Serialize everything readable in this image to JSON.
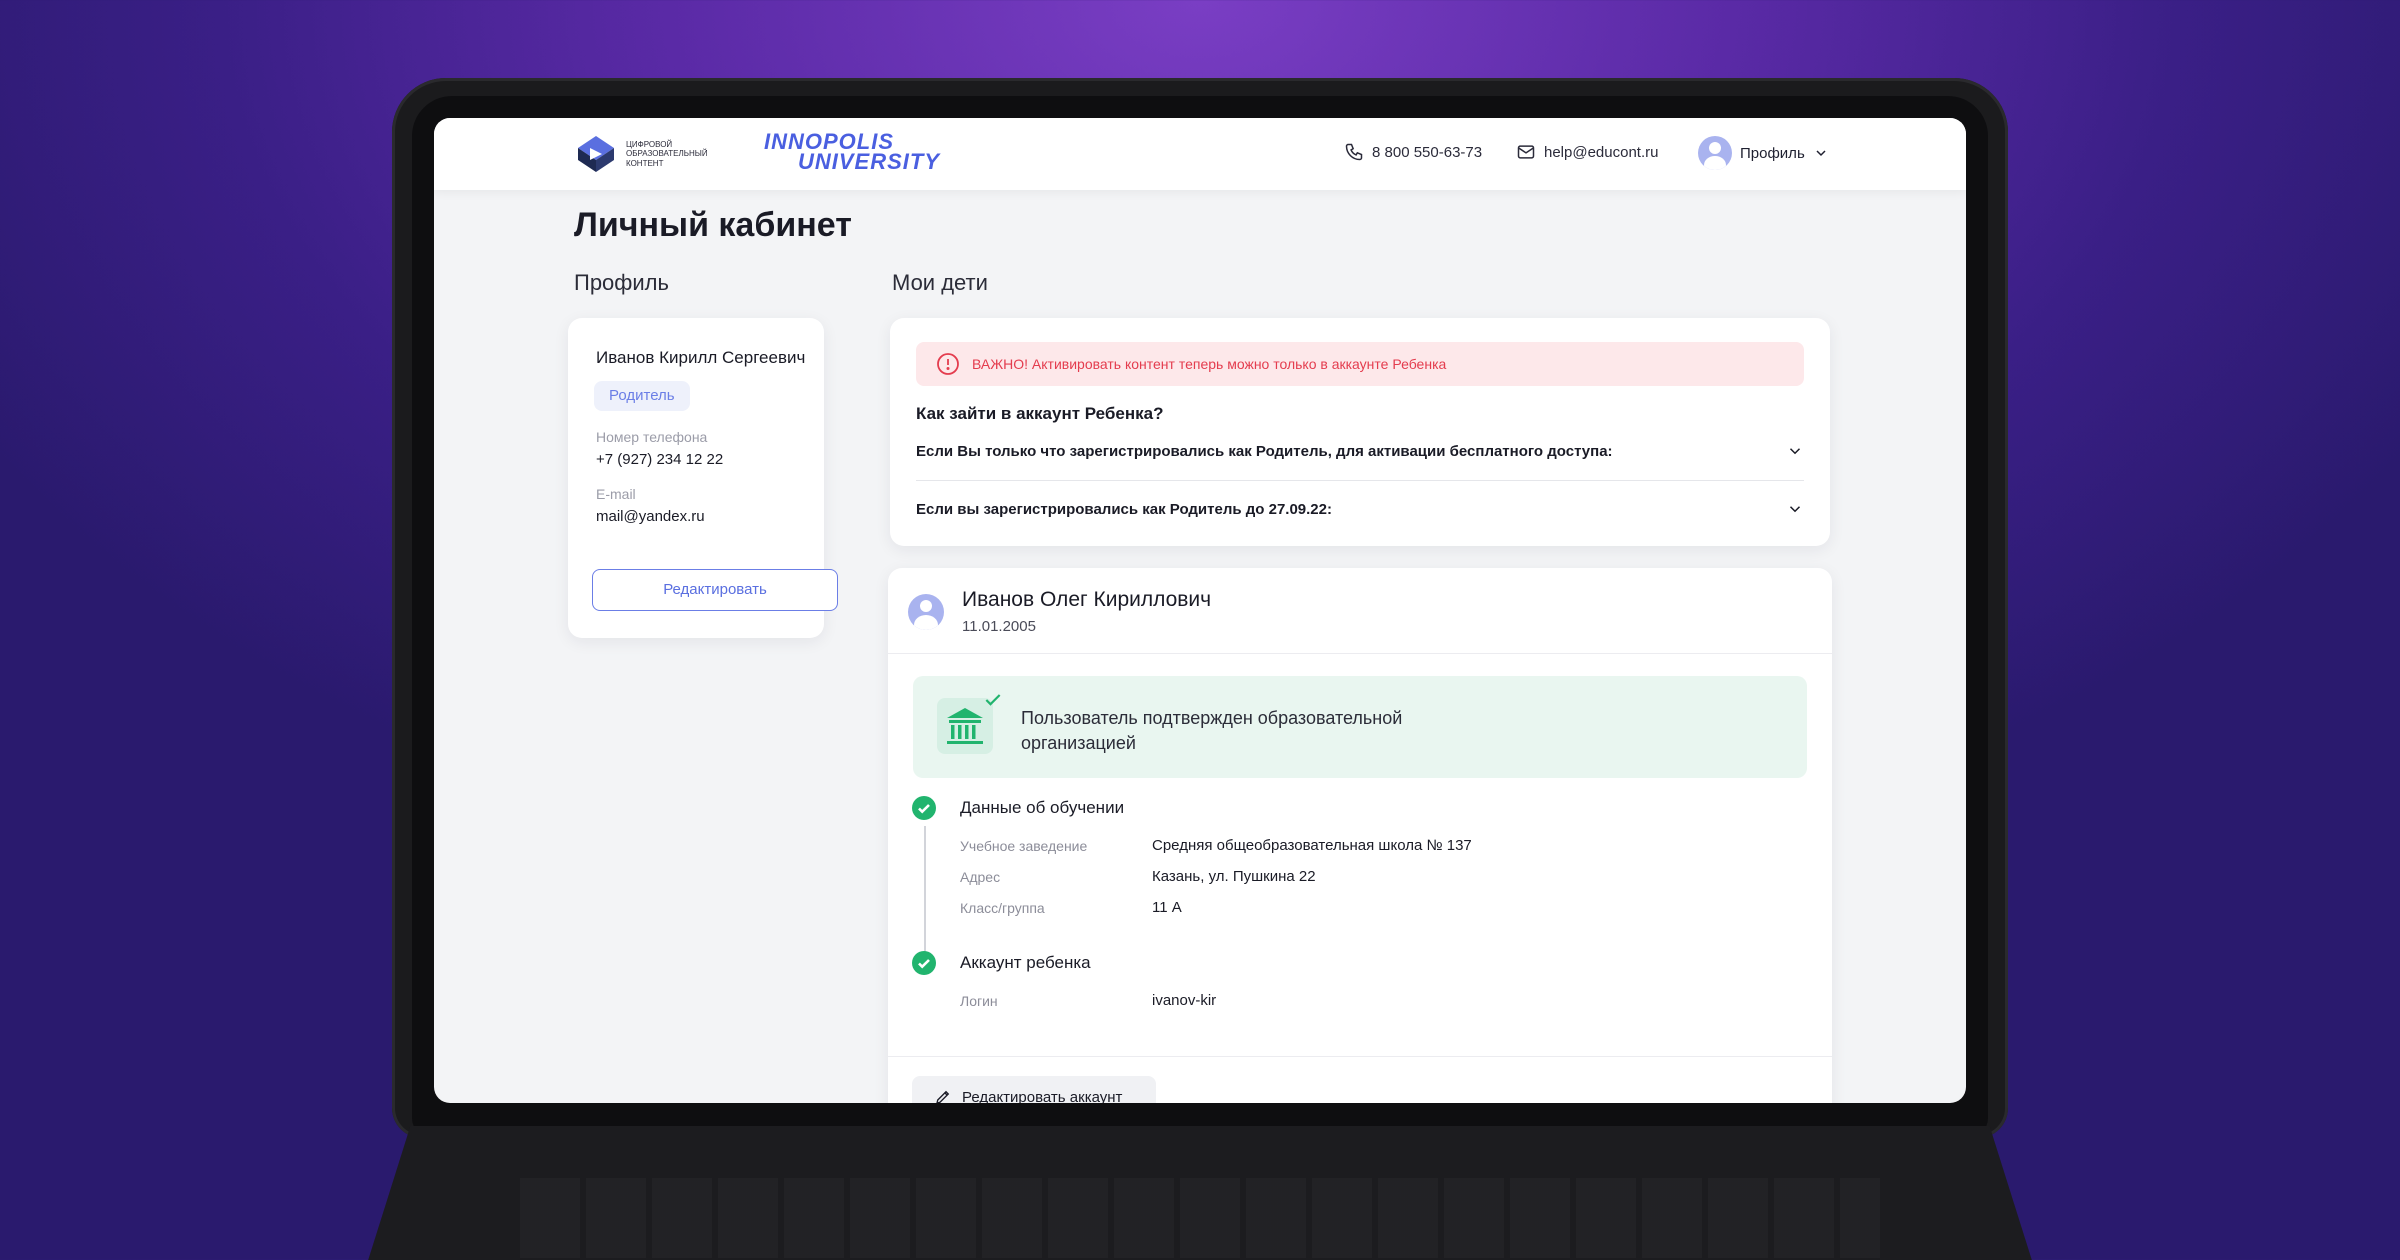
{
  "header": {
    "logo_text": "Цифровой образовательный контент",
    "partner_logo_line1": "INNOPOLIS",
    "partner_logo_line2": "UNIVERSITY",
    "phone": "8 800 550-63-73",
    "email": "help@educont.ru",
    "profile_label": "Профиль"
  },
  "page": {
    "title": "Личный кабинет",
    "profile_section": "Профиль",
    "children_section": "Мои дети"
  },
  "profile": {
    "name": "Иванов Кирилл Сергеевич",
    "role": "Родитель",
    "phone_label": "Номер телефона",
    "phone": "+7 (927) 234 12 22",
    "email_label": "E-mail",
    "email": "mail@yandex.ru",
    "edit_label": "Редактировать"
  },
  "info": {
    "alert": "ВАЖНО! Активировать контент теперь можно только в аккаунте Ребенка",
    "how_title": "Как зайти в аккаунт Ребенка?",
    "accordion": [
      "Если Вы только что зарегистрировались как Родитель, для активации бесплатного доступа:",
      "Если вы зарегистрировались как Родитель до 27.09.22:"
    ]
  },
  "child": {
    "name": "Иванов Олег Кириллович",
    "dob": "11.01.2005",
    "verified_text": "Пользователь подтвержден образовательной организацией",
    "education_title": "Данные об обучении",
    "education": [
      {
        "label": "Учебное заведение",
        "value": "Средняя общеобразовательная школа № 137"
      },
      {
        "label": "Адрес",
        "value": "Казань, ул.  Пушкина 22"
      },
      {
        "label": "Класс/группа",
        "value": "11 А"
      }
    ],
    "account_title": "Аккаунт ребенка",
    "account": [
      {
        "label": "Логин",
        "value": "ivanov-kir"
      }
    ],
    "edit_account_label": "Редактировать аккаунт"
  },
  "colors": {
    "accent": "#5a6fe0",
    "success": "#21b46e",
    "alert": "#e43c4e",
    "alert_bg": "#fde8ea",
    "verified_bg": "#e9f6f0"
  }
}
